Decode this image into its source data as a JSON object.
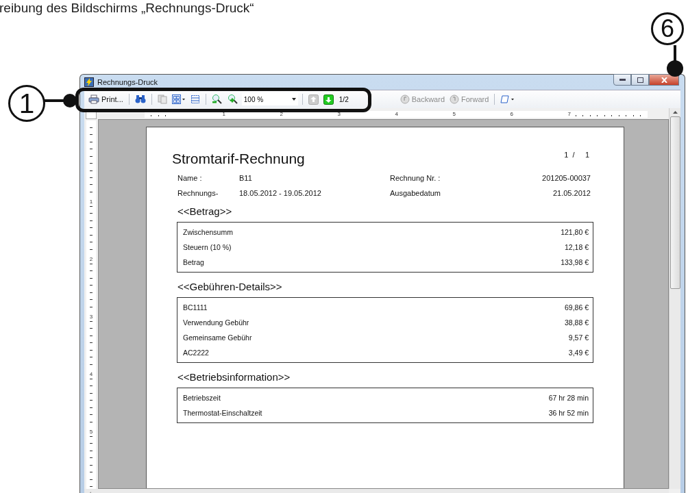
{
  "page_heading": "reibung des Bildschirms „Rechnungs-Druck“",
  "callouts": [
    {
      "number": "1"
    },
    {
      "number": "6"
    }
  ],
  "window": {
    "title": "Rechnungs-Druck"
  },
  "toolbar": [
    {
      "kind": "print",
      "label": "Print..."
    },
    {
      "kind": "separator"
    },
    {
      "kind": "find"
    },
    {
      "kind": "separator"
    },
    {
      "kind": "copy",
      "disabled": true
    },
    {
      "kind": "layout"
    },
    {
      "kind": "pagesetup"
    },
    {
      "kind": "separator"
    },
    {
      "kind": "zoomout"
    },
    {
      "kind": "zoomin"
    },
    {
      "kind": "zoom",
      "value": "100 %"
    },
    {
      "kind": "separator"
    },
    {
      "kind": "pageup",
      "disabled": true
    },
    {
      "kind": "pagedown",
      "disabled": false
    },
    {
      "kind": "pageinfo",
      "label": "1/2"
    },
    {
      "kind": "backward",
      "label": "Backward",
      "disabled": true
    },
    {
      "kind": "forward",
      "label": "Forward",
      "disabled": true
    },
    {
      "kind": "separator"
    },
    {
      "kind": "edit"
    }
  ],
  "ruler": {
    "horizontal": [
      "1",
      "2",
      "3",
      "4",
      "5",
      "6",
      "7"
    ],
    "vertical": [
      "1",
      "2",
      "3",
      "4",
      "5"
    ]
  },
  "document": {
    "page_number": "1  /     1",
    "title": "Stromtarif-Rechnung",
    "info": [
      {
        "label": "Name :",
        "value": "B11",
        "label_2": "Rechnung Nr. :",
        "value_2": "201205-00037"
      },
      {
        "label": "Rechnungs-",
        "value": "18.05.2012 - 19.05.2012",
        "label_2": "Ausgabedatum",
        "value_2": "21.05.2012"
      }
    ],
    "sections": [
      {
        "heading": "<<Betrag>>",
        "rows": [
          {
            "label": "Zwischensumm",
            "value": "121,80 €"
          },
          {
            "label": "Steuern (10 %)",
            "value": "12,18 €"
          },
          {
            "label": "Betrag",
            "value": "133,98 €"
          }
        ]
      },
      {
        "heading": "<<Gebühren-Details>>",
        "rows": [
          {
            "label": "BC1111",
            "value": "69,86 €"
          },
          {
            "label": "Verwendung Gebühr",
            "value": "38,88 €"
          },
          {
            "label": "Gemeinsame Gebühr",
            "value": "9,57 €"
          },
          {
            "label": "AC2222",
            "value": "3,49 €"
          }
        ]
      },
      {
        "heading": "<<Betriebsinformation>>",
        "rows": [
          {
            "label": "Betriebszeit",
            "value": "67 hr 28 min"
          },
          {
            "label": "Thermostat-Einschaltzeit",
            "value": "36 hr 52 min"
          }
        ]
      }
    ]
  }
}
